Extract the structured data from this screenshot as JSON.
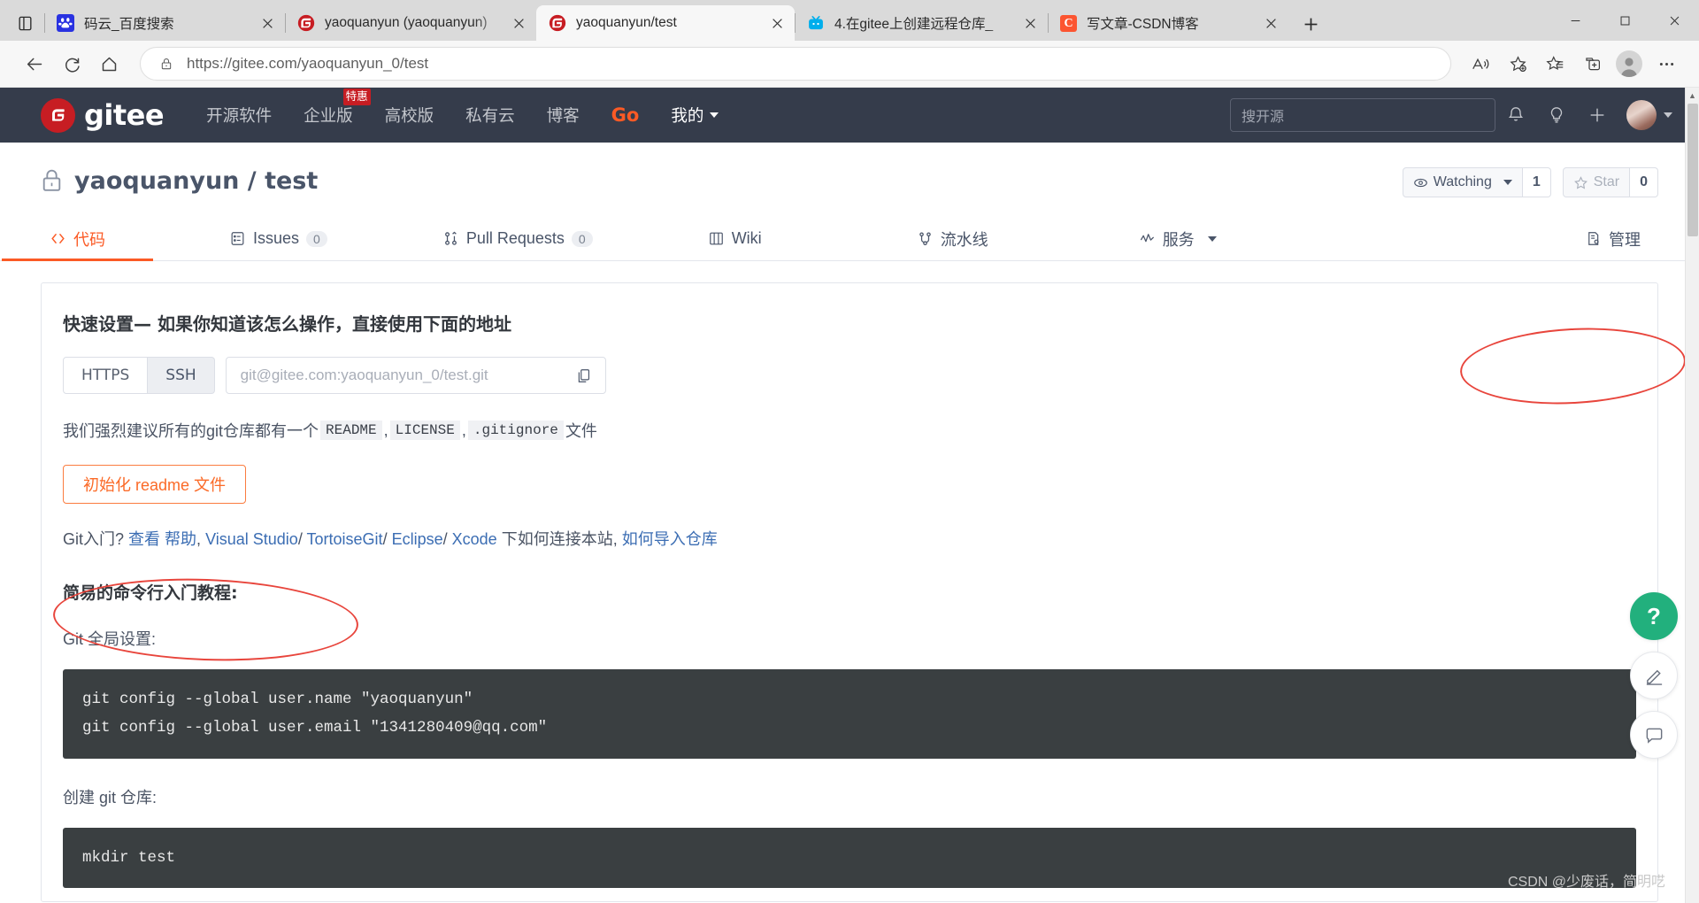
{
  "browser": {
    "tabs": [
      {
        "title": "码云_百度搜索",
        "favicon": "baidu-icon",
        "active": false
      },
      {
        "title": "yaoquanyun (yaoquanyun)",
        "favicon": "gitee-icon",
        "active": false
      },
      {
        "title": "yaoquanyun/test",
        "favicon": "gitee-icon",
        "active": true
      },
      {
        "title": "4.在gitee上创建远程仓库_",
        "favicon": "bilibili-icon",
        "active": false
      },
      {
        "title": "写文章-CSDN博客",
        "favicon": "csdn-icon",
        "active": false
      }
    ],
    "new_tab_label": "+",
    "window_controls": {
      "minimize": "−",
      "maximize": "□",
      "close": "✕"
    },
    "address": {
      "scheme": "https://",
      "host": "gitee.com",
      "path": "/yaoquanyun_0/test",
      "full": "https://gitee.com/yaoquanyun_0/test"
    },
    "toolbar_icons": [
      "back-icon",
      "refresh-icon",
      "home-icon",
      "lock-icon",
      "read-aloud-icon",
      "add-favorite-icon",
      "favorites-icon",
      "collections-icon",
      "profile-icon",
      "settings-more-icon"
    ]
  },
  "gitee_header": {
    "logo_text": "gitee",
    "nav": [
      {
        "label": "开源软件",
        "badge": ""
      },
      {
        "label": "企业版",
        "badge": "特惠"
      },
      {
        "label": "高校版",
        "badge": ""
      },
      {
        "label": "私有云",
        "badge": ""
      },
      {
        "label": "博客",
        "badge": ""
      },
      {
        "label": "Go",
        "badge": ""
      },
      {
        "label": "我的",
        "badge": ""
      }
    ],
    "search_placeholder": "搜开源",
    "icons": [
      "notification-bell-icon",
      "lightbulb-icon",
      "plus-icon",
      "user-avatar"
    ]
  },
  "repo": {
    "owner": "yaoquanyun",
    "separator": "/",
    "name": "test",
    "full_title": "yaoquanyun / test",
    "visibility_icon": "lock-icon",
    "watch": {
      "label": "Watching",
      "count": "1"
    },
    "star": {
      "label": "Star",
      "count": "0"
    },
    "tabs": [
      {
        "label": "代码",
        "icon": "code-icon",
        "count": "",
        "active": true
      },
      {
        "label": "Issues",
        "icon": "issues-icon",
        "count": "0",
        "active": false
      },
      {
        "label": "Pull Requests",
        "icon": "pull-request-icon",
        "count": "0",
        "active": false
      },
      {
        "label": "Wiki",
        "icon": "wiki-icon",
        "count": "",
        "active": false
      },
      {
        "label": "流水线",
        "icon": "pipeline-icon",
        "count": "",
        "active": false
      },
      {
        "label": "服务",
        "icon": "services-icon",
        "count": "",
        "active": false,
        "dropdown": true
      },
      {
        "label": "管理",
        "icon": "manage-icon",
        "count": "",
        "active": false
      }
    ]
  },
  "quick_setup": {
    "heading": "快速设置— 如果你知道该怎么操作，直接使用下面的地址",
    "protocols": [
      {
        "label": "HTTPS",
        "selected": false
      },
      {
        "label": "SSH",
        "selected": true
      }
    ],
    "clone_url": "git@gitee.com:yaoquanyun_0/test.git",
    "copy_icon": "copy-icon",
    "suggest_prefix": "我们强烈建议所有的git仓库都有一个",
    "suggest_files": [
      "README",
      "LICENSE",
      ".gitignore"
    ],
    "suggest_suffix": "文件",
    "init_readme_button": "初始化 readme 文件"
  },
  "git_intro": {
    "lead": "Git入门?",
    "view": "查看",
    "help_link": "帮助",
    "links": [
      "Visual Studio",
      "TortoiseGit",
      "Eclipse",
      "Xcode"
    ],
    "mid_text": "下如何连接本站,",
    "import_link": "如何导入仓库"
  },
  "tutorial": {
    "heading": "简易的命令行入门教程:",
    "sections": [
      {
        "label": "Git 全局设置:",
        "code": "git config --global user.name \"yaoquanyun\"\ngit config --global user.email \"1341280409@qq.com\""
      },
      {
        "label": "创建 git 仓库:",
        "code": "mkdir test"
      }
    ]
  },
  "float_buttons": [
    {
      "icon": "help-icon",
      "label": "?"
    },
    {
      "icon": "edit-icon",
      "label": ""
    },
    {
      "icon": "comment-icon",
      "label": ""
    }
  ],
  "watermark": "CSDN @少废话，简明呓",
  "colors": {
    "gitee_red": "#c71d23",
    "accent_orange": "#fb5a25",
    "header_bg": "#353c4b",
    "annotation_red": "#e8453c",
    "code_bg": "#3a3f41"
  }
}
